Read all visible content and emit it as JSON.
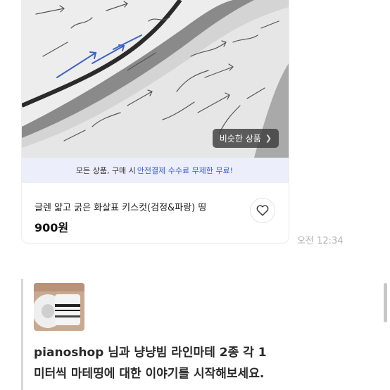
{
  "product": {
    "similar_button_label": "비슷한 상품",
    "promo": {
      "prefix": "모든 상품, 구매 시",
      "highlight": "안전결제 수수료 무제한 무료!"
    },
    "title": "글렌 얇고 굵은 화살표 키스컷(검정&파랑) 띵",
    "price": "900원",
    "icons": {
      "like": "heart-icon",
      "similar": "chevron-right-icon"
    },
    "colors": {
      "promo_bg": "#eceefb",
      "accent": "#3a5bd9"
    }
  },
  "message": {
    "timestamp": "오전 12:34"
  },
  "chat_notice": {
    "line1": "pianoshop 님과 냥냥빔 라인마테 2종 각 1",
    "line2": "미터씩 마테띵에 대한 이야기를 시작해보세요."
  }
}
